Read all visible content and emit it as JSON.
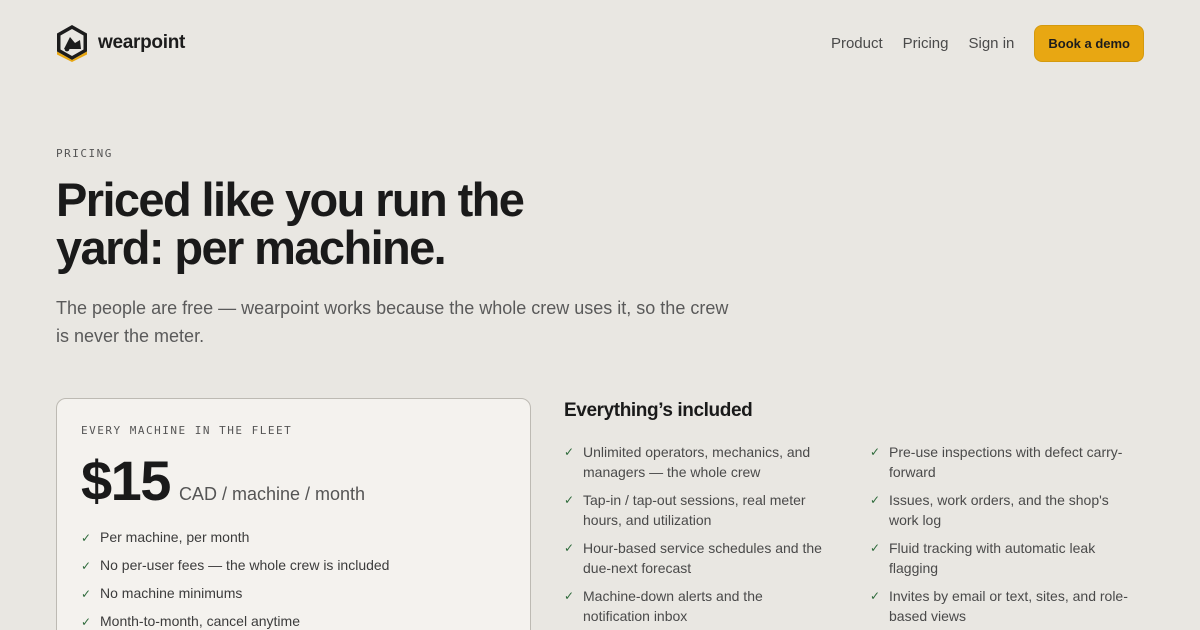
{
  "header": {
    "brand": "wearpoint",
    "nav": [
      "Product",
      "Pricing",
      "Sign in"
    ],
    "cta": "Book a demo"
  },
  "hero": {
    "eyebrow": "PRICING",
    "title_line1": "Priced like you run the",
    "title_line2": "yard: per machine.",
    "subtitle": "The people are free — wearpoint works because the whole crew uses it, so the crew is never the meter."
  },
  "plan": {
    "eyebrow": "EVERY MACHINE IN THE FLEET",
    "price": "$15",
    "unit": "CAD / machine / month",
    "features": [
      "Per machine, per month",
      "No per-user fees — the whole crew is included",
      "No machine minimums",
      "Month-to-month, cancel anytime"
    ]
  },
  "included": {
    "title": "Everything’s included",
    "items": [
      "Unlimited operators, mechanics, and managers — the whole crew",
      "Pre-use inspections with defect carry-forward",
      "Tap-in / tap-out sessions, real meter hours, and utilization",
      "Issues, work orders, and the shop's work log",
      "Hour-based service schedules and the due-next forecast",
      "Fluid tracking with automatic leak flagging",
      "Machine-down alerts and the notification inbox",
      "Invites by email or text, sites, and role-based views"
    ]
  },
  "colors": {
    "accent": "#e8a712",
    "background": "#e9e7e2",
    "check": "#2f6b3c"
  },
  "icons": {
    "logo": "hexagon-excavator-logo",
    "check": "checkmark-icon"
  }
}
